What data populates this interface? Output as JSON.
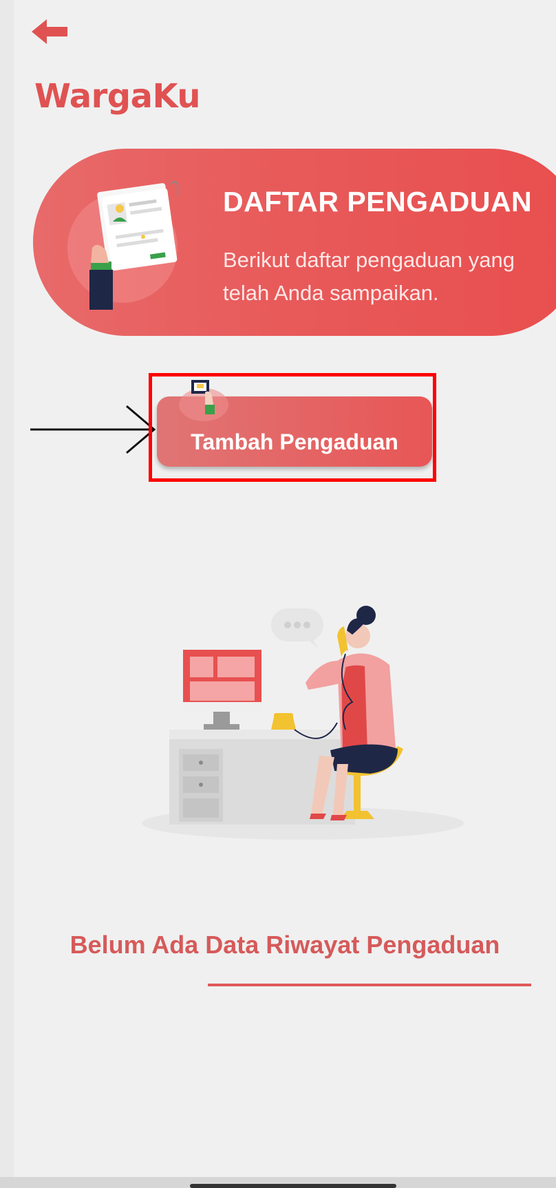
{
  "app": {
    "title": "WargaKu"
  },
  "banner": {
    "title": "DAFTAR PENGADUAN",
    "description": "Berikut daftar pengaduan yang telah Anda sampaikan."
  },
  "actions": {
    "add_complaint_label": "Tambah Pengaduan"
  },
  "empty_state": {
    "message": "Belum Ada Data Riwayat Pengaduan"
  },
  "colors": {
    "brand_red": "#e05252",
    "background": "#f0f0f0",
    "annotation_red": "#ff0000"
  },
  "icons": {
    "back": "arrow-left-icon"
  }
}
